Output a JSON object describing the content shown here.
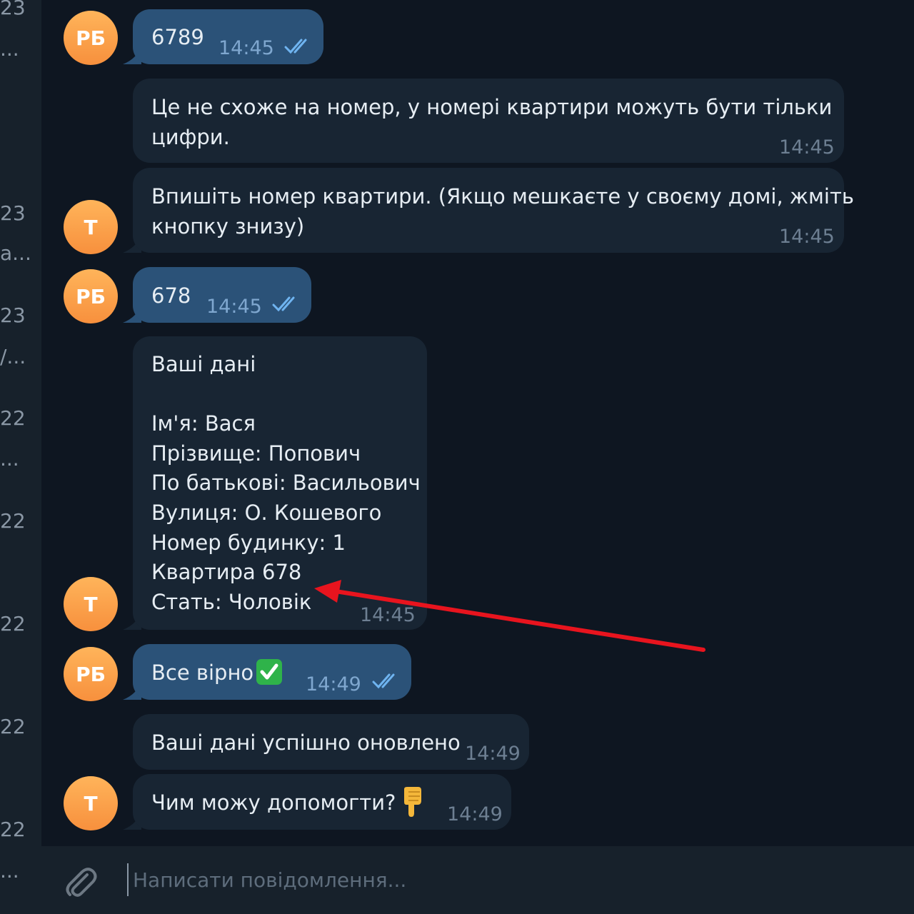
{
  "sidebar_fragments": [
    "23",
    "...",
    "23",
    "а...",
    "23",
    "/...",
    "22",
    "...",
    "22",
    "22",
    "22",
    "22",
    "..."
  ],
  "messages": [
    {
      "sender": "out",
      "avatar": "РБ",
      "text": "6789",
      "time": "14:45"
    },
    {
      "sender": "in",
      "text": "Це не схоже на номер, у номері квартири можуть бути тільки\nцифри.",
      "time": "14:45"
    },
    {
      "sender": "in",
      "avatar": "Т",
      "text": "Впишіть номер квартири. (Якщо мешкаєте у своєму домі, жміть\nкнопку знизу)",
      "time": "14:45"
    },
    {
      "sender": "out",
      "avatar": "РБ",
      "text": "678",
      "time": "14:45"
    },
    {
      "sender": "in",
      "avatar": "Т",
      "text": "Ваші дані\n\nІм'я: Вася\nПрізвище: Попович\nПо батькові: Васильович\nВулиця: О. Кошевого\nНомер будинку: 1\nКвартира 678\nСтать: Чоловік",
      "time": "14:45"
    },
    {
      "sender": "out",
      "avatar": "РБ",
      "text": "Все вірно",
      "emoji": "check-mark-emoji",
      "time": "14:49"
    },
    {
      "sender": "in",
      "text": "Ваші дані успішно оновлено",
      "time": "14:49"
    },
    {
      "sender": "in",
      "avatar": "Т",
      "text": "Чим можу допомогти?",
      "emoji": "pointing-down-emoji",
      "time": "14:49"
    }
  ],
  "composer": {
    "placeholder": "Написати повідомлення...",
    "attach_icon": "paperclip-icon"
  },
  "annotation": {
    "type": "red-arrow",
    "color": "#e8141e",
    "points_to": "Квартира 678"
  },
  "colors": {
    "background": "#0e1621",
    "incoming_bubble": "#182533",
    "outgoing_bubble": "#2b5278",
    "avatar": "#f7903d",
    "ticks": "#6fb4f0"
  }
}
